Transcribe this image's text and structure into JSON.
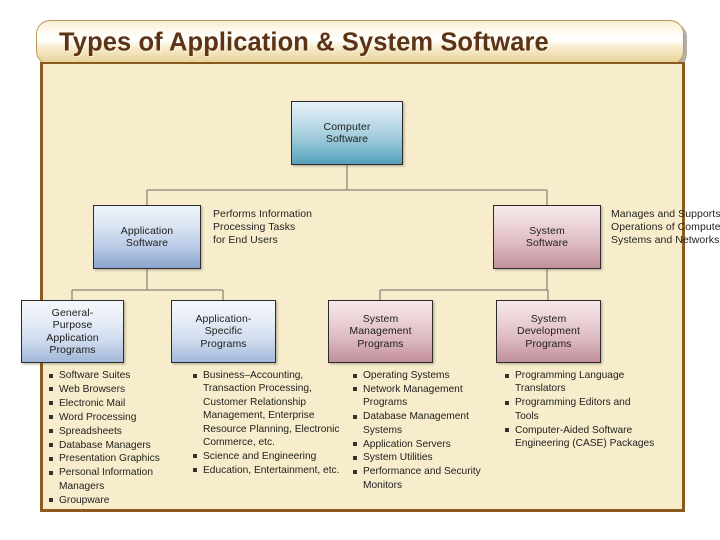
{
  "slide": {
    "title": "Types of Application & System Software",
    "accent_title_color": "#5d3316",
    "panel_bg_color": "#f7edcd",
    "panel_border_color": "#8a5a1e"
  },
  "diagram": {
    "root": {
      "label_line1": "Computer",
      "label_line2": "Software"
    },
    "level2": [
      {
        "label_line1": "Application",
        "label_line2": "Software",
        "annotation_line1": "Performs Information",
        "annotation_line2": "Processing Tasks",
        "annotation_line3": "for End Users"
      },
      {
        "label_line1": "System",
        "label_line2": "Software",
        "annotation_line1": "Manages and Supports",
        "annotation_line2": "Operations of Computer",
        "annotation_line3": "Systems and Networks"
      }
    ],
    "level3": [
      {
        "line1": "General-",
        "line2": "Purpose",
        "line3": "Application",
        "line4": "Programs"
      },
      {
        "line1": "Application-Specific",
        "line2": "Programs",
        "line3": "",
        "line4": ""
      },
      {
        "line1": "System",
        "line2": "Management",
        "line3": "Programs",
        "line4": ""
      },
      {
        "line1": "System",
        "line2": "Development",
        "line3": "Programs",
        "line4": ""
      }
    ],
    "lists": [
      {
        "items": [
          "Software Suites",
          "Web Browsers",
          "Electronic Mail",
          "Word Processing",
          "Spreadsheets",
          "Database Managers",
          "Presentation Graphics",
          "Personal Information Managers",
          "Groupware"
        ]
      },
      {
        "items": [
          "Business–Accounting, Transaction Processing, Customer Relationship Management, Enterprise Resource Planning, Electronic Commerce, etc.",
          "Science and Engineering",
          "Education, Entertainment, etc."
        ]
      },
      {
        "items": [
          "Operating Systems",
          "Network Management Programs",
          "Database Management Systems",
          "Application Servers",
          "System Utilities",
          "Performance and Security Monitors"
        ]
      },
      {
        "items": [
          "Programming Language Translators",
          "Programming Editors and Tools",
          "Computer-Aided Software Engineering (CASE) Packages"
        ]
      }
    ]
  }
}
